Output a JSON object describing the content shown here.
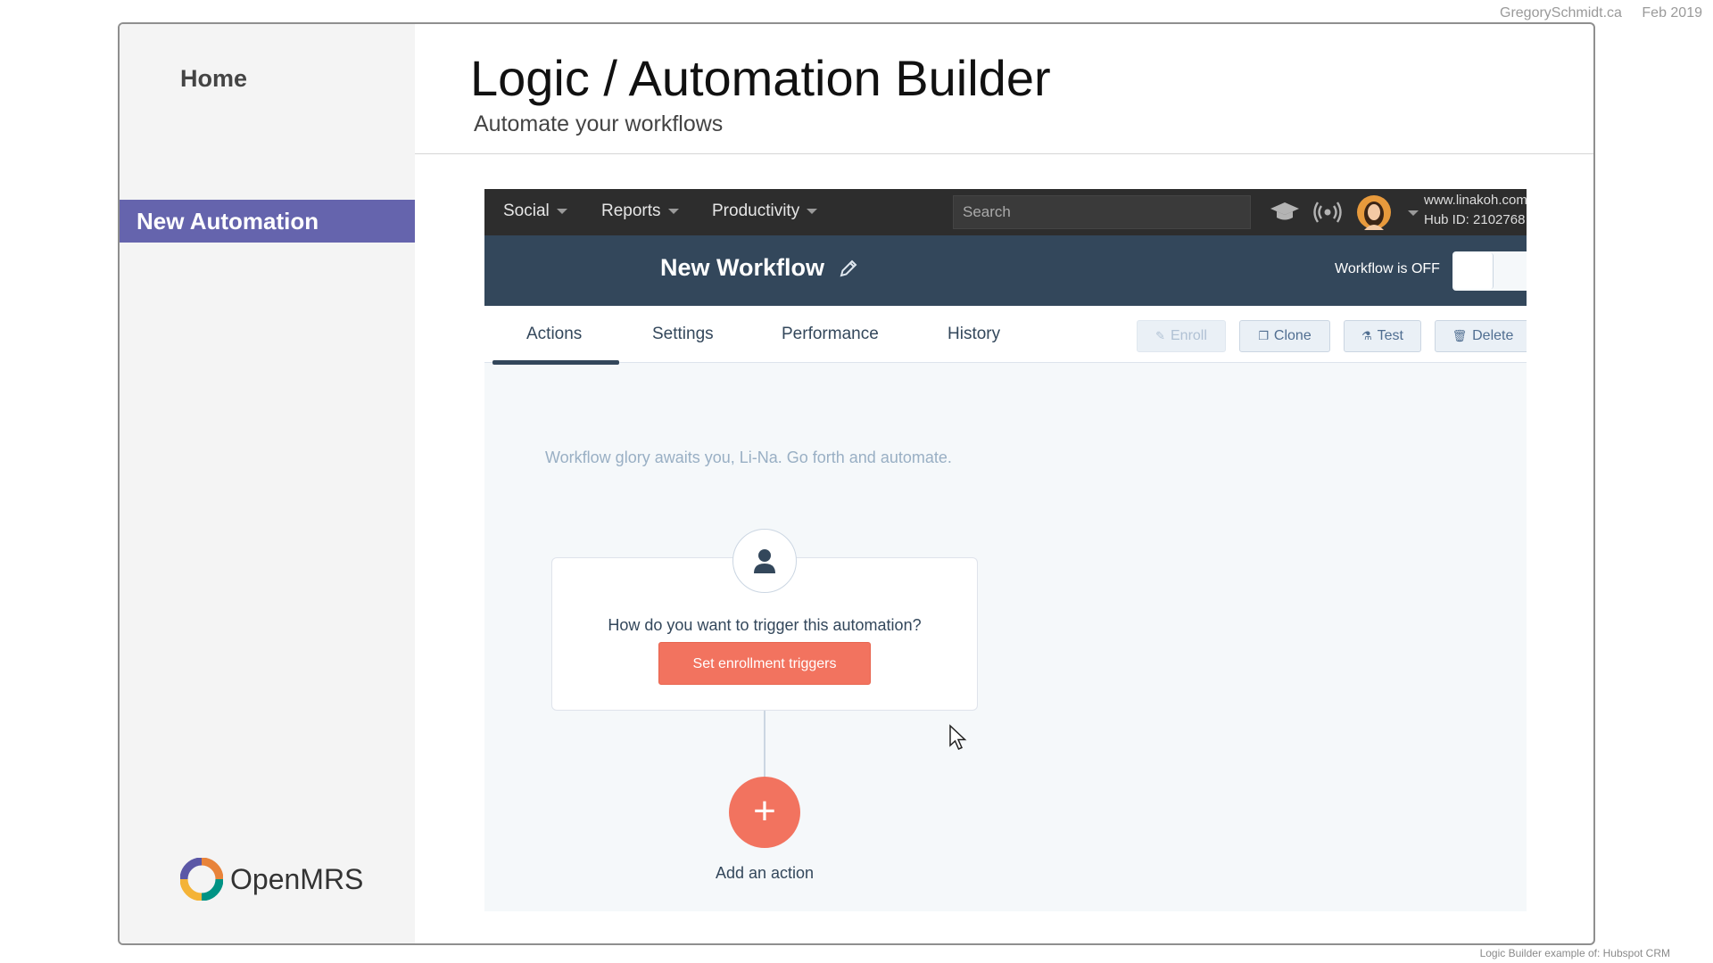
{
  "credits": {
    "site": "GregorySchmidt.ca",
    "date": "Feb 2019"
  },
  "footnote": "Logic Builder example of: Hubspot CRM",
  "sidebar": {
    "home_label": "Home",
    "new_automation_label": "New Automation",
    "logo_text": "OpenMRS"
  },
  "page": {
    "title": "Logic / Automation Builder",
    "subtitle": "Automate your workflows"
  },
  "topnav": {
    "items": [
      {
        "label": "Social"
      },
      {
        "label": "Reports"
      },
      {
        "label": "Productivity"
      }
    ],
    "search_placeholder": "Search",
    "account_domain": "www.linakoh.com",
    "hub_id": "Hub ID: 2102768"
  },
  "workflow": {
    "title": "New Workflow",
    "status": "Workflow is OFF"
  },
  "tabs": [
    {
      "label": "Actions"
    },
    {
      "label": "Settings"
    },
    {
      "label": "Performance"
    },
    {
      "label": "History"
    }
  ],
  "toolbar": {
    "enroll": "Enroll",
    "clone": "Clone",
    "test": "Test",
    "delete": "Delete"
  },
  "canvas": {
    "message": "Workflow glory awaits you, Li-Na. Go forth and automate.",
    "trigger_question": "How do you want to trigger this automation?",
    "trigger_button": "Set enrollment triggers",
    "add_action_label": "Add an action"
  },
  "colors": {
    "sidebar_active": "#6564ad",
    "nav_dark": "#2d2d2d",
    "header_navy": "#33475b",
    "accent_orange": "#f2735f"
  }
}
